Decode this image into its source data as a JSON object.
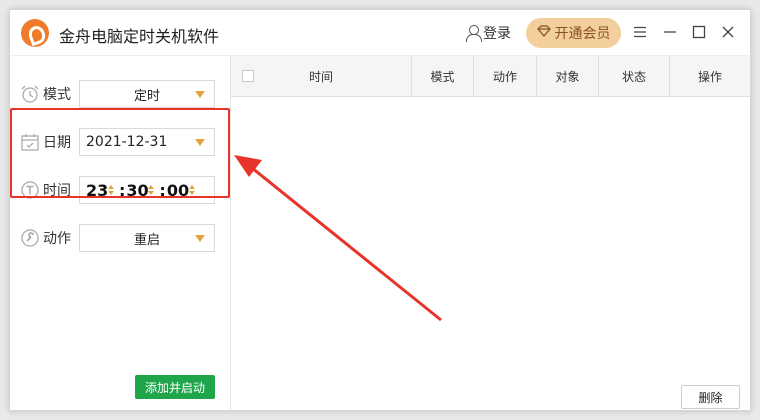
{
  "app": {
    "title": "金舟电脑定时关机软件"
  },
  "header": {
    "login_label": "登录",
    "vip_label": "开通会员"
  },
  "form": {
    "mode": {
      "label": "模式",
      "value": "定时"
    },
    "date": {
      "label": "日期",
      "value": "2021-12-31"
    },
    "time": {
      "label": "时间",
      "hour": "23",
      "minute": "30",
      "second": "00"
    },
    "action": {
      "label": "动作",
      "value": "重启"
    },
    "add_button": "添加并启动"
  },
  "table": {
    "columns": [
      "时间",
      "模式",
      "动作",
      "对象",
      "状态",
      "操作"
    ],
    "rows": []
  },
  "footer": {
    "delete_button": "删除"
  },
  "colors": {
    "accent_orange": "#f07b2a",
    "highlight_red": "#e8332a",
    "start_green": "#1fa64a",
    "vip_gold": "#f3cf9e"
  }
}
